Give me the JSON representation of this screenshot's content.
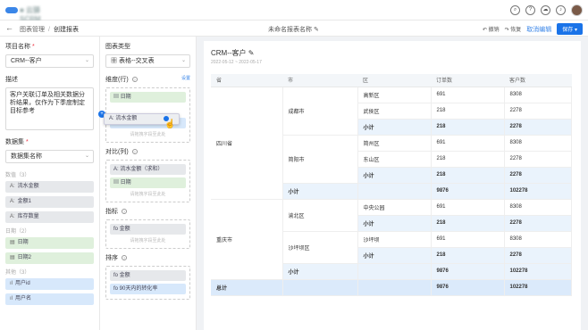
{
  "brand": {
    "logo_text": "■ 云驿SCRM"
  },
  "breadcrumb": {
    "parent": "图表管理",
    "current": "创建报表"
  },
  "report_name": "未命名报表名称",
  "actions": {
    "undo": "撤销",
    "redo": "恢复",
    "cancel_edit": "取消编辑",
    "save": "保存"
  },
  "left": {
    "project_label": "项目名称",
    "project_value": "CRM--客户",
    "desc_label": "描述",
    "desc_value": "客户关联订单及相关数据分析结果，仅作为下季度制定目标参考",
    "dataset_label": "数据集",
    "dataset_value": "数据集名称",
    "group_numeric": "数值（3）",
    "numeric_fields": [
      "流水金额",
      "金额1",
      "库存数量"
    ],
    "group_date": "日期（2）",
    "date_fields": [
      "日期",
      "日期2"
    ],
    "group_other": "其他（3）",
    "other_fields": [
      "用户id",
      "用户名"
    ]
  },
  "mid": {
    "chart_type_label": "图表类型",
    "chart_type_value": "表格--交叉表",
    "dim_row_label": "维度(行)",
    "dim_row_set": "设置",
    "dim_row_fields": [
      "日期",
      "90天内的转化率"
    ],
    "drag_field": "流水金额",
    "hint": "请拖拽字段至此处",
    "dim_col_label": "对比(列)",
    "dim_col_fields": [
      "流水金额（求和）",
      "日期"
    ],
    "metric_label": "指标",
    "metric_fields": [
      "金额"
    ],
    "sort_label": "排序",
    "sort_fields": [
      "金额",
      "90天内的转化率"
    ]
  },
  "report": {
    "title": "CRM--客户",
    "date_range": "2022-05-12 ~ 2022-05-17",
    "headers": [
      "省",
      "市",
      "区",
      "订单数",
      "客户数"
    ],
    "province1": "四川省",
    "city1": "成都市",
    "city1_rows": [
      [
        "高新区",
        "691",
        "8308"
      ],
      [
        "武侯区",
        "218",
        "2278"
      ]
    ],
    "city1_sub": [
      "小计",
      "218",
      "2278"
    ],
    "city2": "简阳市",
    "city2_rows": [
      [
        "简州区",
        "691",
        "8308"
      ],
      [
        "东山区",
        "218",
        "2278"
      ]
    ],
    "city2_sub": [
      "小计",
      "218",
      "2278"
    ],
    "prov1_sub": [
      "小计",
      "9876",
      "102278"
    ],
    "province2": "重庆市",
    "city3": "渝北区",
    "city3_rows": [
      [
        "中央公园",
        "691",
        "8308"
      ]
    ],
    "city3_sub": [
      "小计",
      "218",
      "2278"
    ],
    "city4": "沙坪坝区",
    "city4_rows": [
      [
        "沙坪坝",
        "691",
        "8308"
      ]
    ],
    "city4_sub": [
      "小计",
      "218",
      "2278"
    ],
    "prov2_sub": [
      "小计",
      "9876",
      "102278"
    ],
    "total": [
      "总计",
      "9876",
      "102278"
    ]
  }
}
